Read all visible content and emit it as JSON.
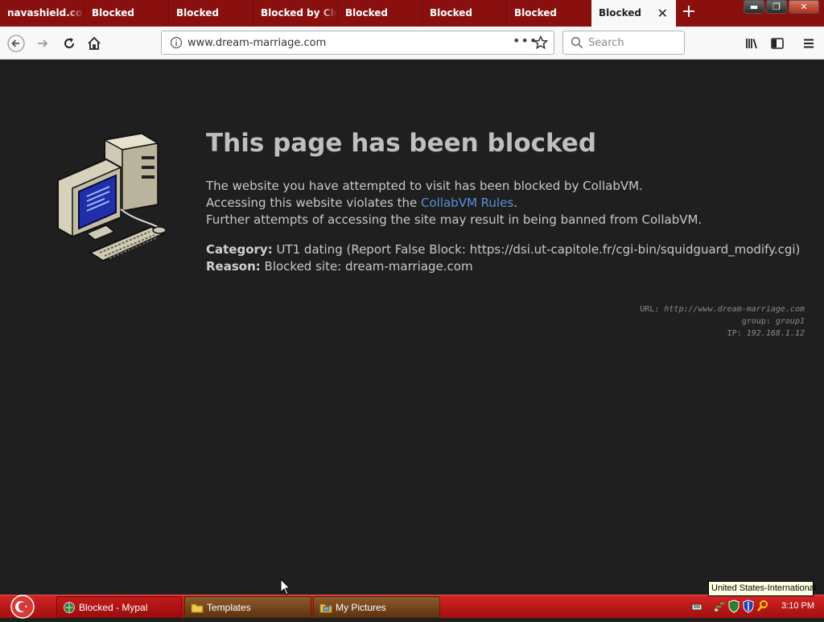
{
  "tabs": [
    {
      "label": "navashield.com"
    },
    {
      "label": "Blocked"
    },
    {
      "label": "Blocked"
    },
    {
      "label": "Blocked by Cloudflare"
    },
    {
      "label": "Blocked"
    },
    {
      "label": "Blocked"
    },
    {
      "label": "Blocked"
    },
    {
      "label": "Blocked",
      "active": true
    }
  ],
  "navbar": {
    "url": "www.dream-marriage.com",
    "search_placeholder": "Search"
  },
  "page": {
    "title": "This page has been blocked",
    "line1": "The website you have attempted to visit has been blocked by CollabVM.",
    "line2_prefix": "Accessing this website violates the ",
    "line2_link": "CollabVM Rules",
    "line2_suffix": ".",
    "line3": "Further attempts of accessing the site may result in being banned from CollabVM.",
    "category_label": "Category:",
    "category_value": " UT1 dating (Report False Block: https://dsi.ut-capitole.fr/cgi-bin/squidguard_modify.cgi)",
    "reason_label": "Reason:",
    "reason_value": " Blocked site: dream-marriage.com",
    "meta_url_label": "URL: ",
    "meta_url_value": "http://www.dream-marriage.com",
    "meta_group_label": "group: ",
    "meta_group_value": "group1",
    "meta_ip_label": "IP: ",
    "meta_ip_value": "192.168.1.12"
  },
  "taskbar": {
    "items": [
      {
        "label": "Blocked - Mypal"
      },
      {
        "label": "Templates"
      },
      {
        "label": "My Pictures"
      }
    ],
    "clock": "3:10 PM",
    "tooltip": "United States-International"
  },
  "colors": {
    "tabstrip": "#8a1010",
    "page_bg": "#1f1f1f",
    "link": "#5b8fd8",
    "taskbar": "#c21a1a"
  }
}
